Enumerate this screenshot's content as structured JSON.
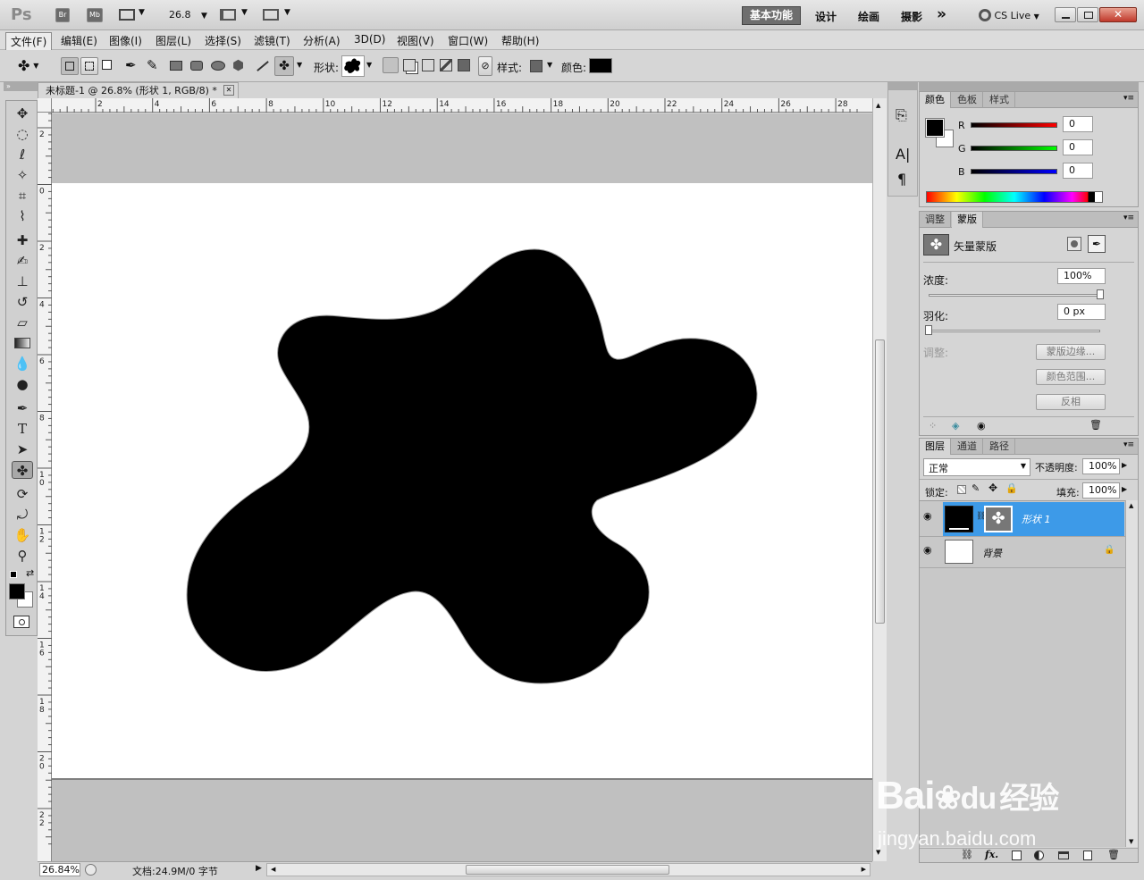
{
  "app": {
    "logo": "Ps",
    "bridge": "Br",
    "minibridge": "Mb",
    "zoom_value": "26.8"
  },
  "workspaces": [
    {
      "label": "基本功能",
      "active": true
    },
    {
      "label": "设计",
      "active": false
    },
    {
      "label": "绘画",
      "active": false
    },
    {
      "label": "摄影",
      "active": false
    }
  ],
  "more_glyph": "»",
  "cs_live": "CS Live",
  "menu": [
    "文件(F)",
    "编辑(E)",
    "图像(I)",
    "图层(L)",
    "选择(S)",
    "滤镜(T)",
    "分析(A)",
    "3D(D)",
    "视图(V)",
    "窗口(W)",
    "帮助(H)"
  ],
  "options": {
    "shape_label": "形状:",
    "style_label": "样式:",
    "color_label": "颜色:",
    "color_value": "#000000"
  },
  "document": {
    "tab_title": "未标题-1 @ 26.8% (形状 1, RGB/8) *",
    "close_glyph": "✕",
    "ruler_h": [
      "2",
      "4",
      "6",
      "8",
      "10",
      "12",
      "14",
      "16",
      "18",
      "20",
      "22",
      "24",
      "26",
      "28"
    ],
    "ruler_v": [
      "2",
      "0",
      "2",
      "4",
      "6",
      "8",
      "1 0",
      "1 2",
      "1 4",
      "1 6",
      "1 8",
      "2 0",
      "2 2"
    ]
  },
  "status": {
    "zoom": "26.84%",
    "doc_info": "文档:24.9M/0 字节"
  },
  "color_panel": {
    "tabs": [
      "颜色",
      "色板",
      "样式"
    ],
    "channels": [
      {
        "name": "R",
        "value": "0",
        "color": "#ff0000"
      },
      {
        "name": "G",
        "value": "0",
        "color": "#00ff00"
      },
      {
        "name": "B",
        "value": "0",
        "color": "#0000ff"
      }
    ]
  },
  "masks_panel": {
    "tabs": [
      "调整",
      "蒙版"
    ],
    "title": "矢量蒙版",
    "density_label": "浓度:",
    "density_value": "100%",
    "density_level": 1.0,
    "feather_label": "羽化:",
    "feather_value": "0 px",
    "feather_level": 0.0,
    "adjust_label": "调整:",
    "buttons": [
      "蒙版边缘...",
      "颜色范围...",
      "反相"
    ]
  },
  "layers_panel": {
    "tabs": [
      "图层",
      "通道",
      "路径"
    ],
    "blend_mode": "正常",
    "opacity_label": "不透明度:",
    "opacity_value": "100%",
    "lock_label": "锁定:",
    "fill_label": "填充:",
    "fill_value": "100%",
    "layers": [
      {
        "name": "形状 1",
        "selected": true
      },
      {
        "name": "背景",
        "selected": false
      }
    ],
    "footer_icons": [
      "link-icon",
      "fx-icon",
      "mask-icon",
      "adjustment-icon",
      "group-icon",
      "new-layer-icon",
      "trash-icon"
    ],
    "fx_text": "fx."
  },
  "watermark": {
    "brand": "Bai",
    "du": "du",
    "cn": "经验",
    "url": "jingyan.baidu.com"
  },
  "colors": {
    "selection": "#3d9ae8",
    "shape": "#000000"
  }
}
